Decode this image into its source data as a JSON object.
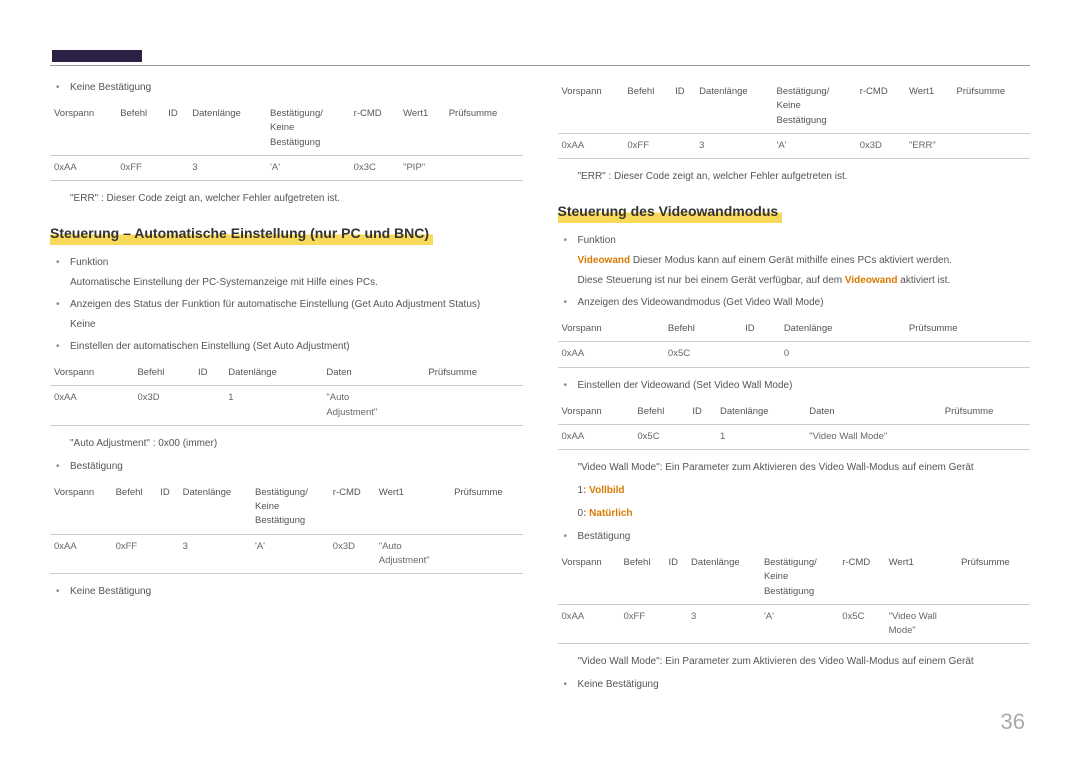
{
  "page_number": "36",
  "left": {
    "bullet_keine": "Keine Bestätigung",
    "table1": {
      "h": [
        "Vorspann",
        "Befehl",
        "ID",
        "Datenlänge",
        "Bestätigung/\nKeine\nBestätigung",
        "r-CMD",
        "Wert1",
        "Prüfsumme"
      ],
      "r": [
        "0xAA",
        "0xFF",
        "",
        "3",
        "'A'",
        "0x3C",
        "\"PIP\"",
        ""
      ]
    },
    "err_note": "\"ERR\" : Dieser Code zeigt an, welcher Fehler aufgetreten ist.",
    "heading": "Steuerung – Automatische Einstellung (nur PC und BNC)",
    "b_funktion": "Funktion",
    "b_funktion_desc": "Automatische Einstellung der PC-Systemanzeige mit Hilfe eines PCs.",
    "b_anzeigen": "Anzeigen des Status der Funktion für automatische Einstellung (Get Auto Adjustment Status)",
    "b_anzeigen_sub": "Keine",
    "b_einstellen": "Einstellen der automatischen Einstellung (Set Auto Adjustment)",
    "table2": {
      "h": [
        "Vorspann",
        "Befehl",
        "ID",
        "Datenlänge",
        "Daten",
        "Prüfsumme"
      ],
      "r": [
        "0xAA",
        "0x3D",
        "",
        "1",
        "\"Auto\nAdjustment\"",
        ""
      ]
    },
    "auto_adj_note": "\"Auto Adjustment\" : 0x00 (immer)",
    "b_best": "Bestätigung",
    "table3": {
      "h": [
        "Vorspann",
        "Befehl",
        "ID",
        "Datenlänge",
        "Bestätigung/\nKeine\nBestätigung",
        "r-CMD",
        "Wert1",
        "Prüfsumme"
      ],
      "r": [
        "0xAA",
        "0xFF",
        "",
        "3",
        "'A'",
        "0x3D",
        "\"Auto\nAdjustment\"",
        ""
      ]
    },
    "b_keine2": "Keine Bestätigung"
  },
  "right": {
    "table1": {
      "h": [
        "Vorspann",
        "Befehl",
        "ID",
        "Datenlänge",
        "Bestätigung/\nKeine\nBestätigung",
        "r-CMD",
        "Wert1",
        "Prüfsumme"
      ],
      "r": [
        "0xAA",
        "0xFF",
        "",
        "3",
        "'A'",
        "0x3D",
        "\"ERR\"",
        ""
      ]
    },
    "err_note": "\"ERR\" : Dieser Code zeigt an, welcher Fehler aufgetreten ist.",
    "heading": "Steuerung des Videowandmodus",
    "b_funktion": "Funktion",
    "videowand_lbl": "Videowand",
    "videowand_txt1": " Dieser Modus kann auf einem Gerät mithilfe eines PCs aktiviert werden.",
    "videowand_txt2_a": "Diese Steuerung ist nur bei einem Gerät verfügbar, auf dem ",
    "videowand_txt2_b": " aktiviert ist.",
    "b_anzeigen": "Anzeigen des Videowandmodus (Get Video Wall Mode)",
    "table2": {
      "h": [
        "Vorspann",
        "Befehl",
        "ID",
        "Datenlänge",
        "Prüfsumme"
      ],
      "r": [
        "0xAA",
        "0x5C",
        "",
        "0",
        ""
      ]
    },
    "b_einstellen": "Einstellen der Videowand (Set Video Wall Mode)",
    "table3": {
      "h": [
        "Vorspann",
        "Befehl",
        "ID",
        "Datenlänge",
        "Daten",
        "Prüfsumme"
      ],
      "r": [
        "0xAA",
        "0x5C",
        "",
        "1",
        "\"Video Wall Mode\"",
        ""
      ]
    },
    "vwm_note": "\"Video Wall Mode\": Ein Parameter zum Aktivieren des Video Wall-Modus auf einem Gerät",
    "mode1_n": "1",
    "mode1_l": ": Vollbild",
    "mode0_n": "0",
    "mode0_l": ": Natürlich",
    "b_best": "Bestätigung",
    "table4": {
      "h": [
        "Vorspann",
        "Befehl",
        "ID",
        "Datenlänge",
        "Bestätigung/\nKeine\nBestätigung",
        "r-CMD",
        "Wert1",
        "Prüfsumme"
      ],
      "r": [
        "0xAA",
        "0xFF",
        "",
        "3",
        "'A'",
        "0x5C",
        "\"Video Wall\nMode\"",
        ""
      ]
    },
    "vwm_note2": "\"Video Wall Mode\": Ein Parameter zum Aktivieren des Video Wall-Modus auf einem Gerät",
    "b_keine": "Keine Bestätigung"
  }
}
